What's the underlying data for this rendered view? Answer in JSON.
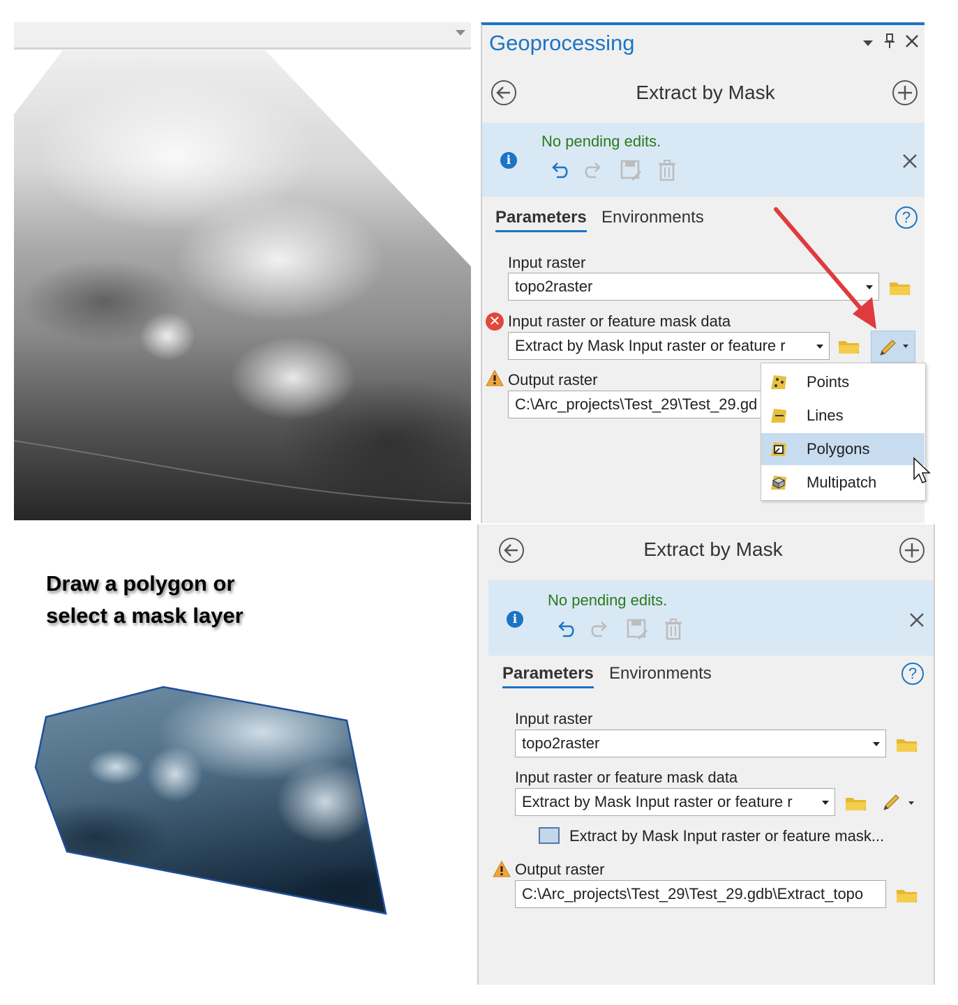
{
  "top_panel": {
    "pane_title": "Geoprocessing",
    "tool_title": "Extract by Mask",
    "banner_text": "No pending edits.",
    "tabs": [
      {
        "label": "Parameters",
        "active": true
      },
      {
        "label": "Environments",
        "active": false
      }
    ],
    "help_glyph": "?",
    "input_raster_label": "Input raster",
    "input_raster_value": "topo2raster",
    "mask_label": "Input raster or feature mask data",
    "mask_value": "Extract by Mask Input raster or feature r",
    "output_label": "Output raster",
    "output_value": "C:\\Arc_projects\\Test_29\\Test_29.gd",
    "draw_menu": [
      "Points",
      "Lines",
      "Polygons",
      "Multipatch"
    ],
    "highlighted_item": "Polygons"
  },
  "bottom_panel": {
    "tool_title": "Extract by Mask",
    "banner_text": "No pending edits.",
    "tabs": [
      {
        "label": "Parameters",
        "active": true
      },
      {
        "label": "Environments",
        "active": false
      }
    ],
    "help_glyph": "?",
    "input_raster_label": "Input raster",
    "input_raster_value": "topo2raster",
    "mask_label": "Input raster or feature mask data",
    "mask_value": "Extract by Mask Input raster or feature r",
    "mask_layer_item": "Extract by Mask Input raster or feature mask...",
    "output_label": "Output raster",
    "output_value": "C:\\Arc_projects\\Test_29\\Test_29.gdb\\Extract_topo"
  },
  "headline": {
    "line1": "Draw a polygon or",
    "line2": "select a mask layer"
  },
  "icons": {
    "info": "info-icon",
    "close": "close-icon",
    "back": "back-arrow-icon",
    "add": "add-icon",
    "undo": "undo-icon",
    "redo": "redo-icon",
    "save": "save-edits-icon",
    "discard": "discard-edits-icon",
    "folder": "folder-icon",
    "pencil": "pencil-icon",
    "error": "error-icon",
    "warning": "warning-icon"
  },
  "colors": {
    "accent": "#1c74c4",
    "banner_bg": "#d9e8f5",
    "banner_text": "#2c7a1b",
    "panel_bg": "#f0f0f0",
    "error": "#e0483a",
    "warning": "#f2a33a",
    "mask_polygon_edge": "#1f4e9a",
    "arrow_red": "#e03a3e"
  }
}
